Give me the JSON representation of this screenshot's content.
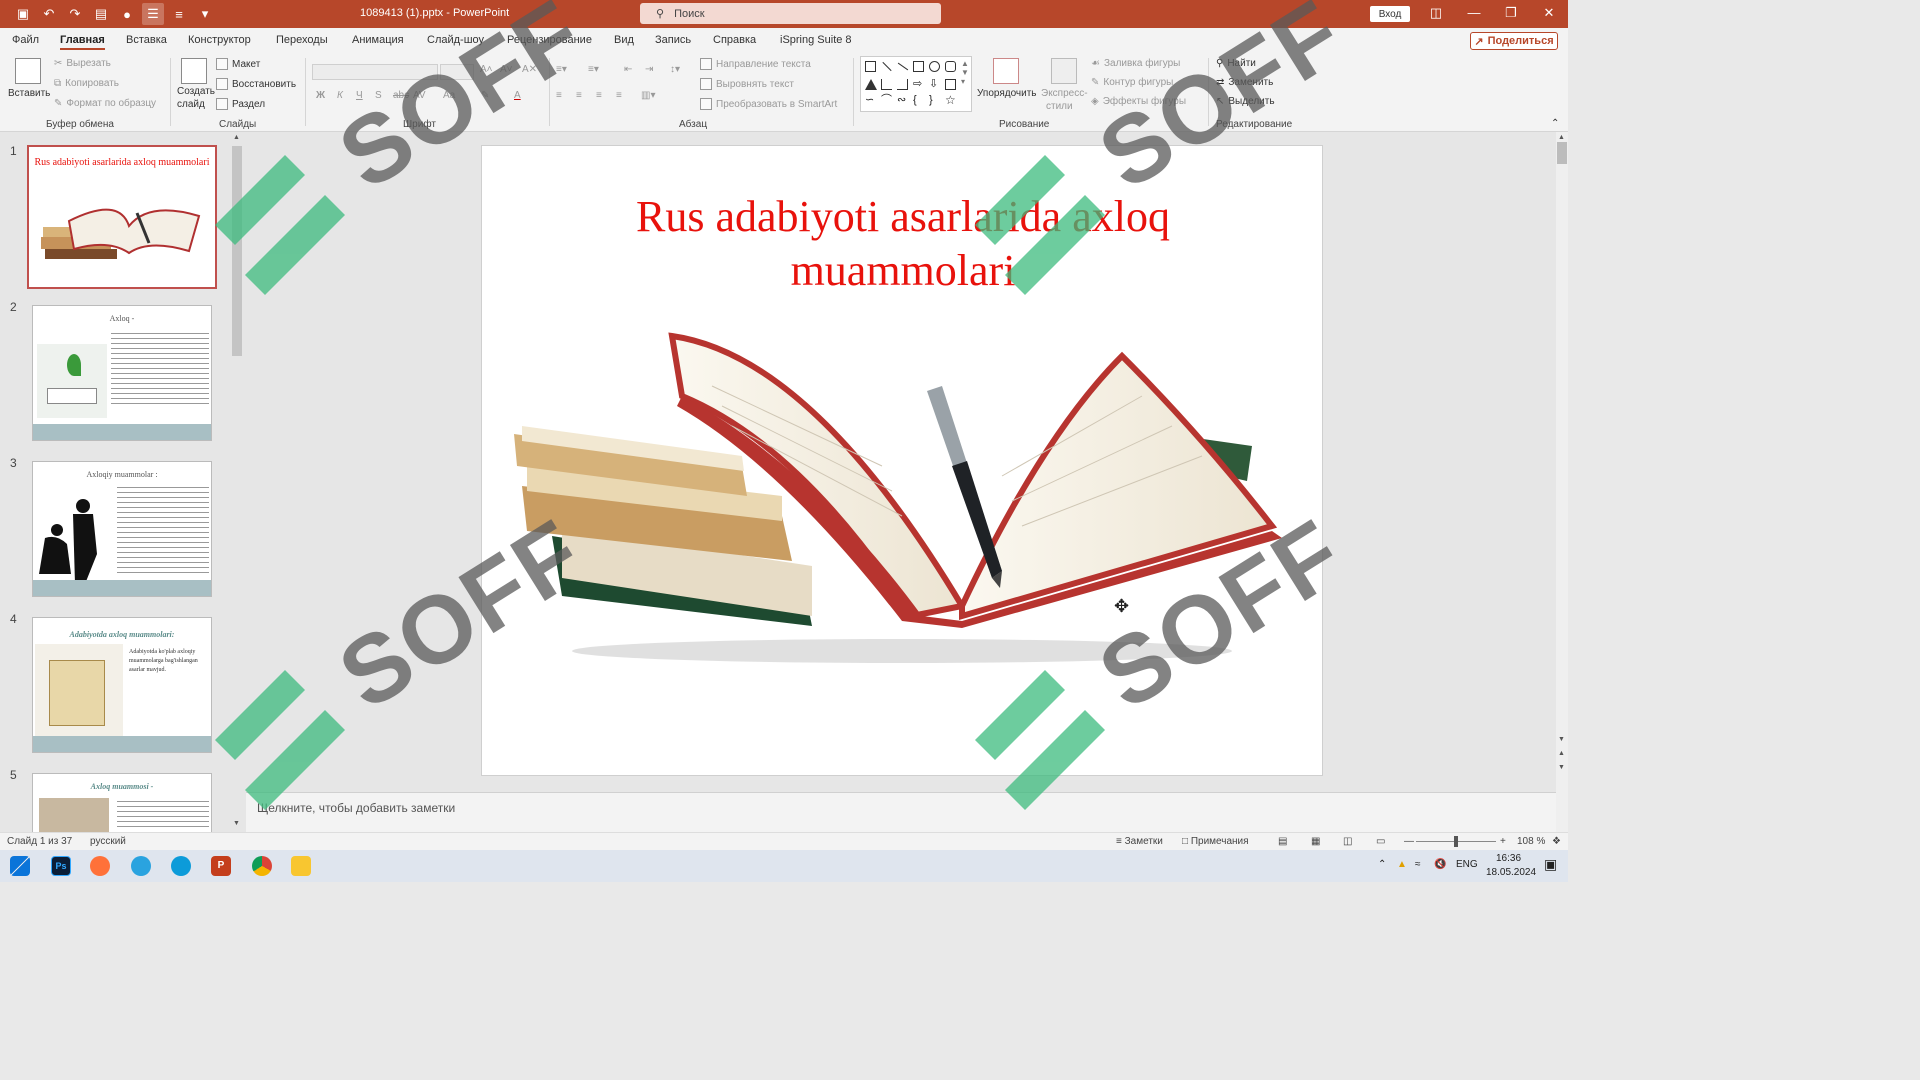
{
  "app": {
    "doc_title": "1089413 (1).pptx  -  PowerPoint",
    "search_placeholder": "Поиск",
    "signin": "Вход",
    "share": "Поделиться"
  },
  "menu": {
    "tabs": [
      "Файл",
      "Главная",
      "Вставка",
      "Конструктор",
      "Переходы",
      "Анимация",
      "Слайд-шоу",
      "Рецензирование",
      "Вид",
      "Запись",
      "Справка",
      "iSpring Suite 8"
    ],
    "active": "Главная"
  },
  "ribbon": {
    "clipboard": {
      "paste": "Вставить",
      "cut": "Вырезать",
      "copy": "Копировать",
      "format_painter": "Формат по образцу",
      "label": "Буфер обмена"
    },
    "slides": {
      "new_slide_line1": "Создать",
      "new_slide_line2": "слайд",
      "layout": "Макет",
      "reset": "Восстановить",
      "section": "Раздел",
      "label": "Слайды"
    },
    "font": {
      "label": "Шрифт",
      "bold": "Ж",
      "italic": "К",
      "underline": "Ч",
      "shadow": "S",
      "strike": "abc",
      "spacing": "AV",
      "case": "Aa",
      "color": "A"
    },
    "paragraph": {
      "label": "Абзац",
      "text_direction": "Направление текста",
      "align_text": "Выровнять текст",
      "smartart": "Преобразовать в SmartArt"
    },
    "drawing": {
      "label": "Рисование",
      "arrange": "Упорядочить",
      "quick_styles_line1": "Экспресс-",
      "quick_styles_line2": "стили",
      "fill": "Заливка фигуры",
      "outline": "Контур фигуры",
      "effects": "Эффекты фигуры"
    },
    "editing": {
      "label": "Редактирование",
      "find": "Найти",
      "replace": "Заменить",
      "select": "Выделить"
    }
  },
  "thumbnails": [
    {
      "num": "1",
      "title": "Rus adabiyoti asarlarida axloq muammolari"
    },
    {
      "num": "2",
      "title": "Axloq -"
    },
    {
      "num": "3",
      "title": "Axloqiy muammolar :"
    },
    {
      "num": "4",
      "title": "Adabiyotda axloq muammolari:",
      "body": "Adabiyotda ko'plab axloqiy muammolarga bag'ishlangan asarlar mavjud."
    },
    {
      "num": "5",
      "title": "Axloq muammosi -"
    }
  ],
  "slide": {
    "title_line1": "Rus adabiyoti asarlarida axloq",
    "title_line2": "muammolari"
  },
  "notes_placeholder": "Щелкните, чтобы добавить заметки",
  "status": {
    "slide_of": "Слайд 1 из 37",
    "language": "русский",
    "notes": "Заметки",
    "comments": "Примечания",
    "zoom": "108 %"
  },
  "taskbar": {
    "lang": "ENG",
    "time": "16:36",
    "date": "18.05.2024"
  },
  "watermark": "SOFF",
  "colors": {
    "accent": "#b7472a",
    "title_red": "#e8120c",
    "watermark_green": "#3dbb7e"
  }
}
